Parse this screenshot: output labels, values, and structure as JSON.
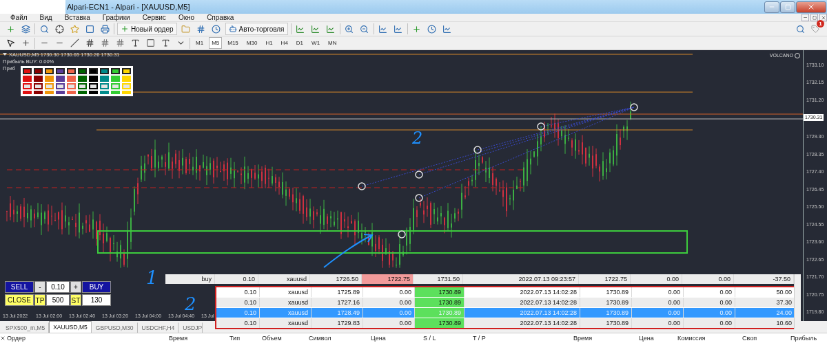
{
  "window": {
    "title": "Alpari-ECN1 - Alpari - [XAUUSD,M5]"
  },
  "menu": [
    "Файл",
    "Вид",
    "Вставка",
    "Графики",
    "Сервис",
    "Окно",
    "Справка"
  ],
  "toolbar": {
    "new_order": "Новый ордер",
    "auto_trading": "Авто-торговля",
    "notifications": "1"
  },
  "timeframes": [
    {
      "label": "M1",
      "selected": false
    },
    {
      "label": "M5",
      "selected": true
    },
    {
      "label": "M15",
      "selected": false
    },
    {
      "label": "M30",
      "selected": false
    },
    {
      "label": "H1",
      "selected": false
    },
    {
      "label": "H4",
      "selected": false
    },
    {
      "label": "D1",
      "selected": false
    },
    {
      "label": "W1",
      "selected": false
    },
    {
      "label": "MN",
      "selected": false
    }
  ],
  "chart": {
    "header": "XAUUSD,M5 1730.30 1730.65 1730.26 1730.31",
    "info": [
      "Прибыль BUY: 0.00%",
      "Приб"
    ],
    "indicator": "VOLCANO",
    "price_axis": [
      "1733.10",
      "1732.15",
      "1731.20",
      "1729.30",
      "1728.35",
      "1727.40",
      "1726.45",
      "1725.50",
      "1724.55",
      "1723.60",
      "1722.65",
      "1721.70",
      "1720.75",
      "1719.80"
    ],
    "current_price": "1730.31",
    "time_axis": [
      "13 Jul 2022",
      "13 Jul 02:00",
      "13 Jul 02:40",
      "13 Jul 03:20",
      "13 Jul 04:00",
      "13 Jul 04:40",
      "13 Jul"
    ]
  },
  "palette": [
    {
      "color": "#e01010"
    },
    {
      "color": "#8b0000"
    },
    {
      "color": "#f0960a"
    },
    {
      "color": "#5a3c9a"
    },
    {
      "color": "#f0644a"
    },
    {
      "color": "#006400"
    },
    {
      "color": "#000000"
    },
    {
      "color": "#008b8b"
    },
    {
      "color": "#32cd32"
    },
    {
      "color": "#ffd700"
    }
  ],
  "annotations": [
    "2",
    "1",
    "2"
  ],
  "trade_panel": {
    "sell": "SELL",
    "minus": "-",
    "lot": "0.10",
    "plus": "+",
    "buy": "BUY",
    "close": "CLOSE",
    "tp_label": "TP",
    "tp": "500",
    "st_label": "ST",
    "st": "130"
  },
  "orders": [
    {
      "type": "buy",
      "volume": "0.10",
      "symbol": "xauusd",
      "price": "1726.50",
      "sl": "1722.75",
      "tp": "1731.50",
      "time": "2022.07.13 09:23:57",
      "current": "1722.75",
      "commission": "0.00",
      "swap": "0.00",
      "profit": "-37.50",
      "sl_hit": true,
      "tp_hit": false,
      "selected": false
    }
  ],
  "marked_orders": [
    {
      "volume": "0.10",
      "symbol": "xauusd",
      "price": "1725.89",
      "sl": "0.00",
      "tp": "1730.89",
      "time": "2022.07.13 14:02:28",
      "current": "1730.89",
      "commission": "0.00",
      "swap": "0.00",
      "profit": "50.00",
      "sl_hit": false,
      "tp_hit": true,
      "selected": false
    },
    {
      "volume": "0.10",
      "symbol": "xauusd",
      "price": "1727.16",
      "sl": "0.00",
      "tp": "1730.89",
      "time": "2022.07.13 14:02:28",
      "current": "1730.89",
      "commission": "0.00",
      "swap": "0.00",
      "profit": "37.30",
      "sl_hit": false,
      "tp_hit": true,
      "selected": false
    },
    {
      "volume": "0.10",
      "symbol": "xauusd",
      "price": "1728.49",
      "sl": "0.00",
      "tp": "1730.89",
      "time": "2022.07.13 14:02:28",
      "current": "1730.89",
      "commission": "0.00",
      "swap": "0.00",
      "profit": "24.00",
      "sl_hit": false,
      "tp_hit": true,
      "selected": true
    },
    {
      "volume": "0.10",
      "symbol": "xauusd",
      "price": "1729.83",
      "sl": "0.00",
      "tp": "1730.89",
      "time": "2022.07.13 14:02:28",
      "current": "1730.89",
      "commission": "0.00",
      "swap": "0.00",
      "profit": "10.60",
      "sl_hit": false,
      "tp_hit": true,
      "selected": false
    }
  ],
  "symbol_tabs": [
    {
      "label": "SPX500_m,M5",
      "selected": false
    },
    {
      "label": "XAUUSD,M5",
      "selected": true
    },
    {
      "label": "GBPUSD,M30",
      "selected": false
    },
    {
      "label": "USDCHF,H4",
      "selected": false
    },
    {
      "label": "USDJP",
      "selected": false
    }
  ],
  "terminal": {
    "columns": [
      "Ордер",
      "Время",
      "Тип",
      "Объем",
      "Символ",
      "Цена",
      "S / L",
      "T / P",
      "Время",
      "Цена",
      "Комиссия",
      "Своп",
      "Прибыль"
    ]
  }
}
